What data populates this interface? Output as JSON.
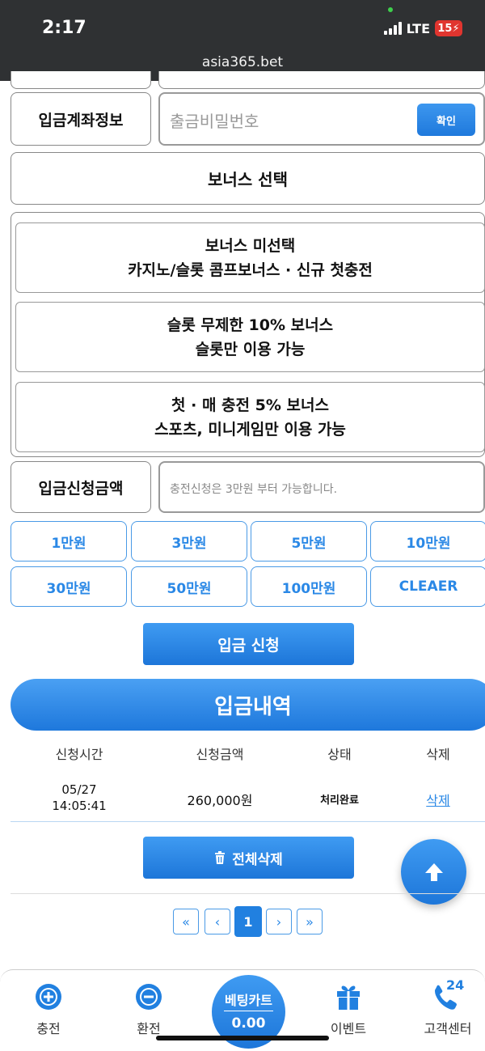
{
  "status_bar": {
    "time": "2:17",
    "network": "LTE",
    "battery": "15",
    "url": "asia365.bet"
  },
  "account_info": {
    "label": "입금계좌정보",
    "password_placeholder": "출금비밀번호",
    "confirm_label": "확인"
  },
  "bonus": {
    "select_label": "보너스 선택",
    "options": [
      {
        "line1": "보너스 미선택",
        "line2": "카지노/슬롯 콤프보너스 · 신규 첫충전"
      },
      {
        "line1": "슬롯 무제한 10% 보너스",
        "line2": "슬롯만 이용 가능"
      },
      {
        "line1": "첫 · 매 충전 5% 보너스",
        "line2": "스포츠, 미니게임만 이용 가능"
      }
    ]
  },
  "deposit_amount": {
    "label": "입금신청금액",
    "placeholder": "충전신청은 3만원 부터 가능합니다."
  },
  "amount_buttons": [
    "1만원",
    "3만원",
    "5만원",
    "10만원",
    "30만원",
    "50만원",
    "100만원",
    "CLEAER"
  ],
  "deposit_button": "입금 신청",
  "history": {
    "title": "입금내역",
    "columns": [
      "신청시간",
      "신청금액",
      "상태",
      "삭제"
    ],
    "rows": [
      {
        "date": "05/27",
        "time": "14:05:41",
        "amount": "260,000원",
        "status": "처리완료",
        "delete": "삭제"
      }
    ],
    "delete_all": "전체삭제"
  },
  "pagination": {
    "first": "«",
    "prev": "‹",
    "current": "1",
    "next": "›",
    "last": "»"
  },
  "bottom_nav": {
    "charge": "충전",
    "exchange": "환전",
    "betcart_title": "베팅카트",
    "betcart_value": "0.00",
    "event": "이벤트",
    "support": "고객센터",
    "support_badge": "24"
  },
  "colors": {
    "accent": "#2180e0",
    "status_bar": "#2f3133",
    "battery": "#e0352f"
  }
}
